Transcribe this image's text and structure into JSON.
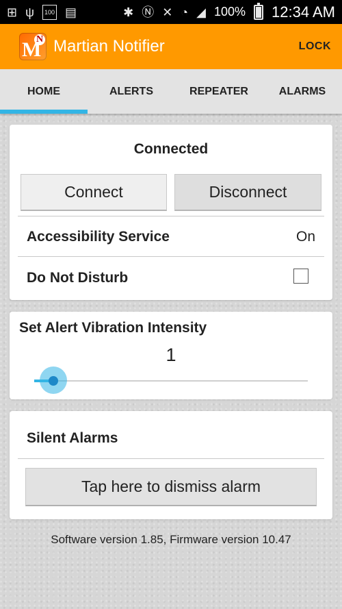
{
  "status_bar": {
    "battery_percent": "100%",
    "time": "12:34 AM",
    "icons_left": [
      "add-box-icon",
      "usb-icon",
      "battery-100-icon",
      "sd-card-icon"
    ],
    "icons_right": [
      "bluetooth-icon",
      "nfc-icon",
      "mute-icon",
      "wifi-icon",
      "signal-icon",
      "battery-icon"
    ],
    "battery_badge": "100"
  },
  "app_bar": {
    "title": "Martian Notifier",
    "lock_label": "LOCK",
    "logo_letter": "M",
    "logo_badge": "N",
    "color": "#ff9900"
  },
  "tabs": [
    {
      "label": "HOME",
      "active": true
    },
    {
      "label": "ALERTS",
      "active": false
    },
    {
      "label": "REPEATER",
      "active": false
    },
    {
      "label": "ALARMS",
      "active": false
    }
  ],
  "connection": {
    "status": "Connected",
    "connect_label": "Connect",
    "disconnect_label": "Disconnect"
  },
  "settings": {
    "accessibility_label": "Accessibility Service",
    "accessibility_value": "On",
    "dnd_label": "Do Not Disturb",
    "dnd_checked": false
  },
  "vibration": {
    "title": "Set Alert Vibration Intensity",
    "value": "1",
    "level_fraction": 0.07,
    "accent": "#33b5e5"
  },
  "alarms": {
    "title": "Silent Alarms",
    "dismiss_label": "Tap here to dismiss alarm"
  },
  "footer": {
    "version_text": "Software version 1.85, Firmware version 10.47"
  }
}
